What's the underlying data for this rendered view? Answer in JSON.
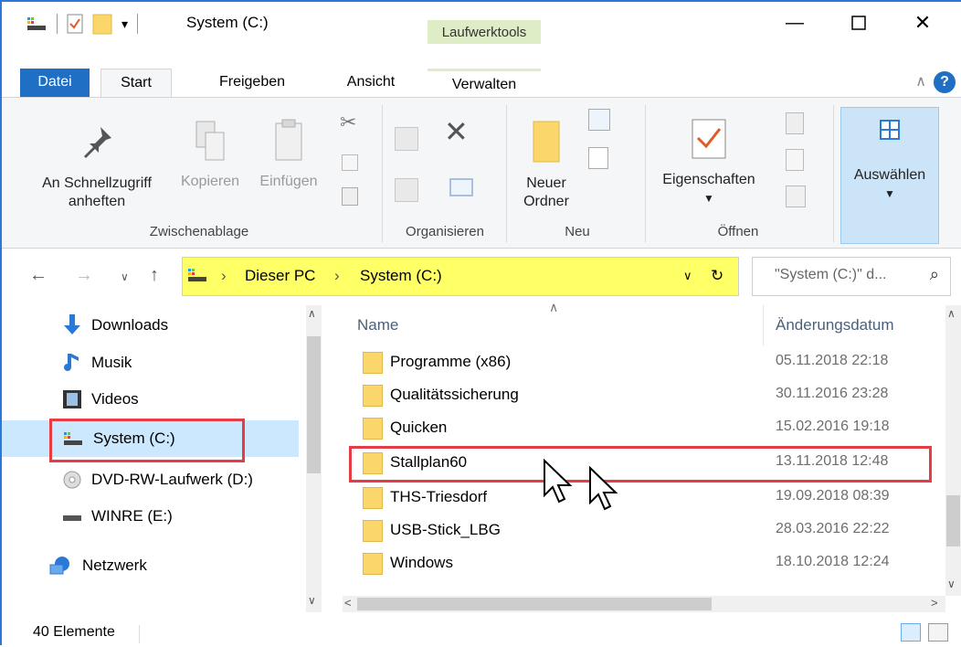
{
  "window": {
    "title": "System (C:)",
    "context_tab": "Laufwerktools"
  },
  "tabs": [
    "Datei",
    "Start",
    "Freigeben",
    "Ansicht",
    "Verwalten"
  ],
  "ribbon": {
    "pin_label_1": "An Schnellzugriff",
    "pin_label_2": "anheften",
    "copy": "Kopieren",
    "paste": "Einfügen",
    "new_folder_1": "Neuer",
    "new_folder_2": "Ordner",
    "properties": "Eigenschaften",
    "select": "Auswählen",
    "groups": {
      "clipboard": "Zwischenablage",
      "organize": "Organisieren",
      "new": "Neu",
      "open": "Öffnen"
    }
  },
  "address": {
    "crumbs": [
      "Dieser PC",
      "System (C:)"
    ],
    "search_placeholder": "\"System (C:)\" d..."
  },
  "nav_pane": {
    "items": [
      "Downloads",
      "Musik",
      "Videos",
      "System (C:)",
      "DVD-RW-Laufwerk (D:)",
      "WINRE (E:)",
      "Netzwerk"
    ]
  },
  "file_list": {
    "columns": [
      "Name",
      "Änderungsdatum"
    ],
    "rows": [
      {
        "name": "Programme (x86)",
        "date": "05.11.2018 22:18"
      },
      {
        "name": "Qualitätssicherung",
        "date": "30.11.2016 23:28"
      },
      {
        "name": "Quicken",
        "date": "15.02.2016 19:18"
      },
      {
        "name": "Stallplan60",
        "date": "13.11.2018 12:48"
      },
      {
        "name": "THS-Triesdorf",
        "date": "19.09.2018 08:39"
      },
      {
        "name": "USB-Stick_LBG",
        "date": "28.03.2016 22:22"
      },
      {
        "name": "Windows",
        "date": "18.10.2018 12:24"
      }
    ]
  },
  "status": {
    "count": "40 Elemente"
  },
  "colors": {
    "accent": "#1f6fc5",
    "highlight": "#ffff66",
    "annotation": "#e53d46",
    "selection": "#cce8ff"
  }
}
